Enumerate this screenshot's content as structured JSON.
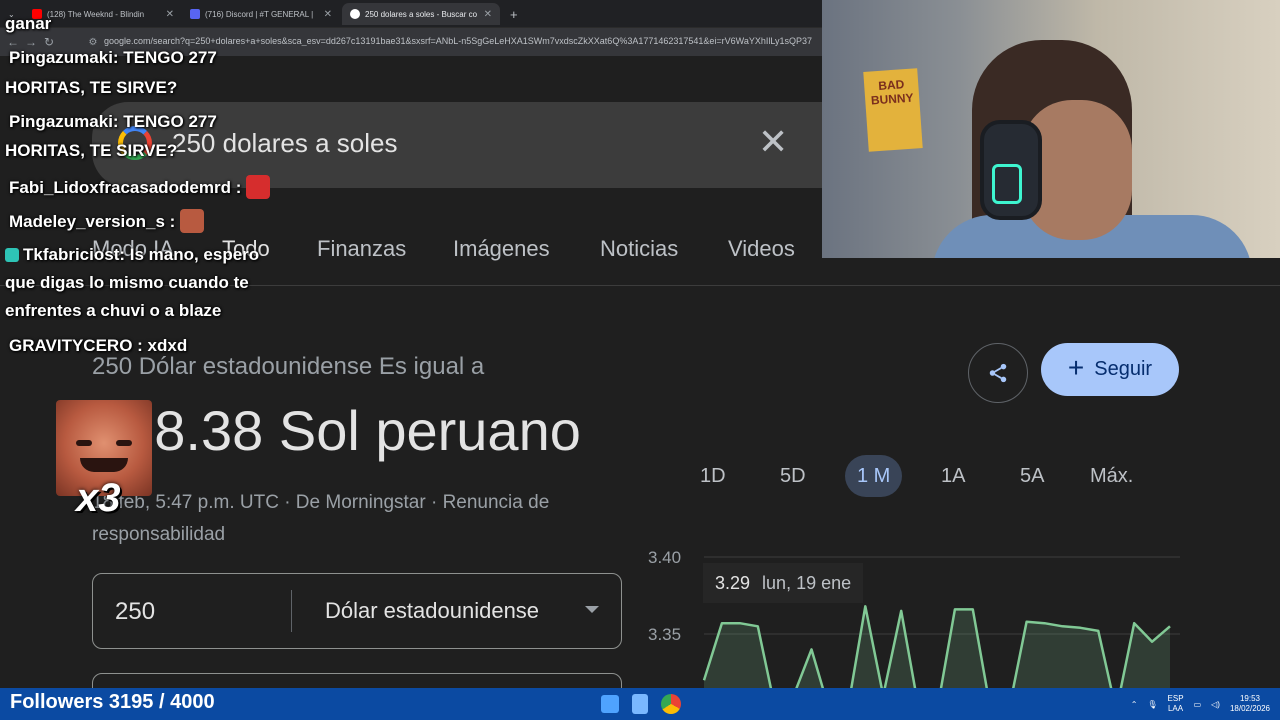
{
  "browser": {
    "tabs": [
      {
        "label": "(128) The Weeknd - Blindin",
        "favicon_color": "#ff0000",
        "active": false
      },
      {
        "label": "(716) Discord | #T GENERAL |",
        "favicon_color": "#5865f2",
        "active": false
      },
      {
        "label": "250 dolares a soles - Buscar co",
        "favicon_color": "#ffffff",
        "active": true
      }
    ],
    "new_tab_label": "+",
    "url": "google.com/search?q=250+dolares+a+soles&sca_esv=dd267c13191bae31&sxsrf=ANbL-n5SgGeLeHXA1SWm7vxdscZkXXat6Q%3A1771462317541&ei=rV6WaYXhIlLy1sQP37"
  },
  "search": {
    "query": "250 dolares a soles",
    "tabs": [
      "Modo IA",
      "Todo",
      "Finanzas",
      "Imágenes",
      "Noticias",
      "Videos"
    ],
    "active_tab": "Todo"
  },
  "converter": {
    "label": "250 Dólar estadounidense Es igual a",
    "result": "838.38 Sol peruano",
    "meta": "18 feb, 5:47 p.m. UTC · De Morningstar · Renuncia de responsabilidad",
    "share_icon": "share-icon",
    "follow_label": "Seguir",
    "ranges": [
      "1D",
      "5D",
      "1 M",
      "1A",
      "5A",
      "Máx."
    ],
    "active_range": "1 M",
    "amount": "250",
    "currency": "Dólar estadounidense"
  },
  "chart_data": {
    "type": "line",
    "y_ticks": [
      "3.40",
      "3.35"
    ],
    "ylim": [
      3.3,
      3.4
    ],
    "values": [
      3.32,
      3.357,
      3.357,
      3.355,
      3.3,
      3.31,
      3.34,
      3.3,
      3.3,
      3.368,
      3.31,
      3.365,
      3.3,
      3.3,
      3.366,
      3.366,
      3.3,
      3.3,
      3.358,
      3.357,
      3.355,
      3.354,
      3.352,
      3.3,
      3.357,
      3.345,
      3.355
    ],
    "tooltip_value": "3.29",
    "tooltip_date": "lun, 19 ene",
    "line_color": "#81c995"
  },
  "chat": [
    {
      "user": "Pingazumaki",
      "user_color": "#ffb6c1",
      "text": ": TENGO 277"
    },
    {
      "user": "",
      "user_color": "#ffffff",
      "text": "HORITAS, TE SIRVE?"
    },
    {
      "user": "Pingazumaki",
      "user_color": "#ffb6c1",
      "text": ": TENGO 277"
    },
    {
      "user": "",
      "user_color": "#ffffff",
      "text": "HORITAS, TE SIRVE?"
    },
    {
      "user": "Fabi_Lidoxfracasadodemrd",
      "user_color": "#3d8bff",
      "text": " :"
    },
    {
      "user": "Madeley_version_s",
      "user_color": "#e0245e",
      "text": " :"
    },
    {
      "user": "Tkfabriciost",
      "user_color": "#7fff5a",
      "text": ": Is mano, espero"
    },
    {
      "user": "",
      "user_color": "#ffffff",
      "text": "que digas lo mismo cuando te"
    },
    {
      "user": "",
      "user_color": "#ffffff",
      "text": "enfrentes a chuvi o a blaze"
    },
    {
      "user": "GRAVITYCERO",
      "user_color": "#ffc56b",
      "text": " : xdxd"
    }
  ],
  "chat_top": "ganar",
  "overlay": {
    "combo": "x3",
    "followers": "Followers 3195 / 4000"
  },
  "webcam": {
    "poster_text": "BAD BUNNY"
  },
  "taskbar": {
    "lang_1": "ESP",
    "lang_2": "LAA",
    "time": "19:53",
    "date": "18/02/2026"
  }
}
